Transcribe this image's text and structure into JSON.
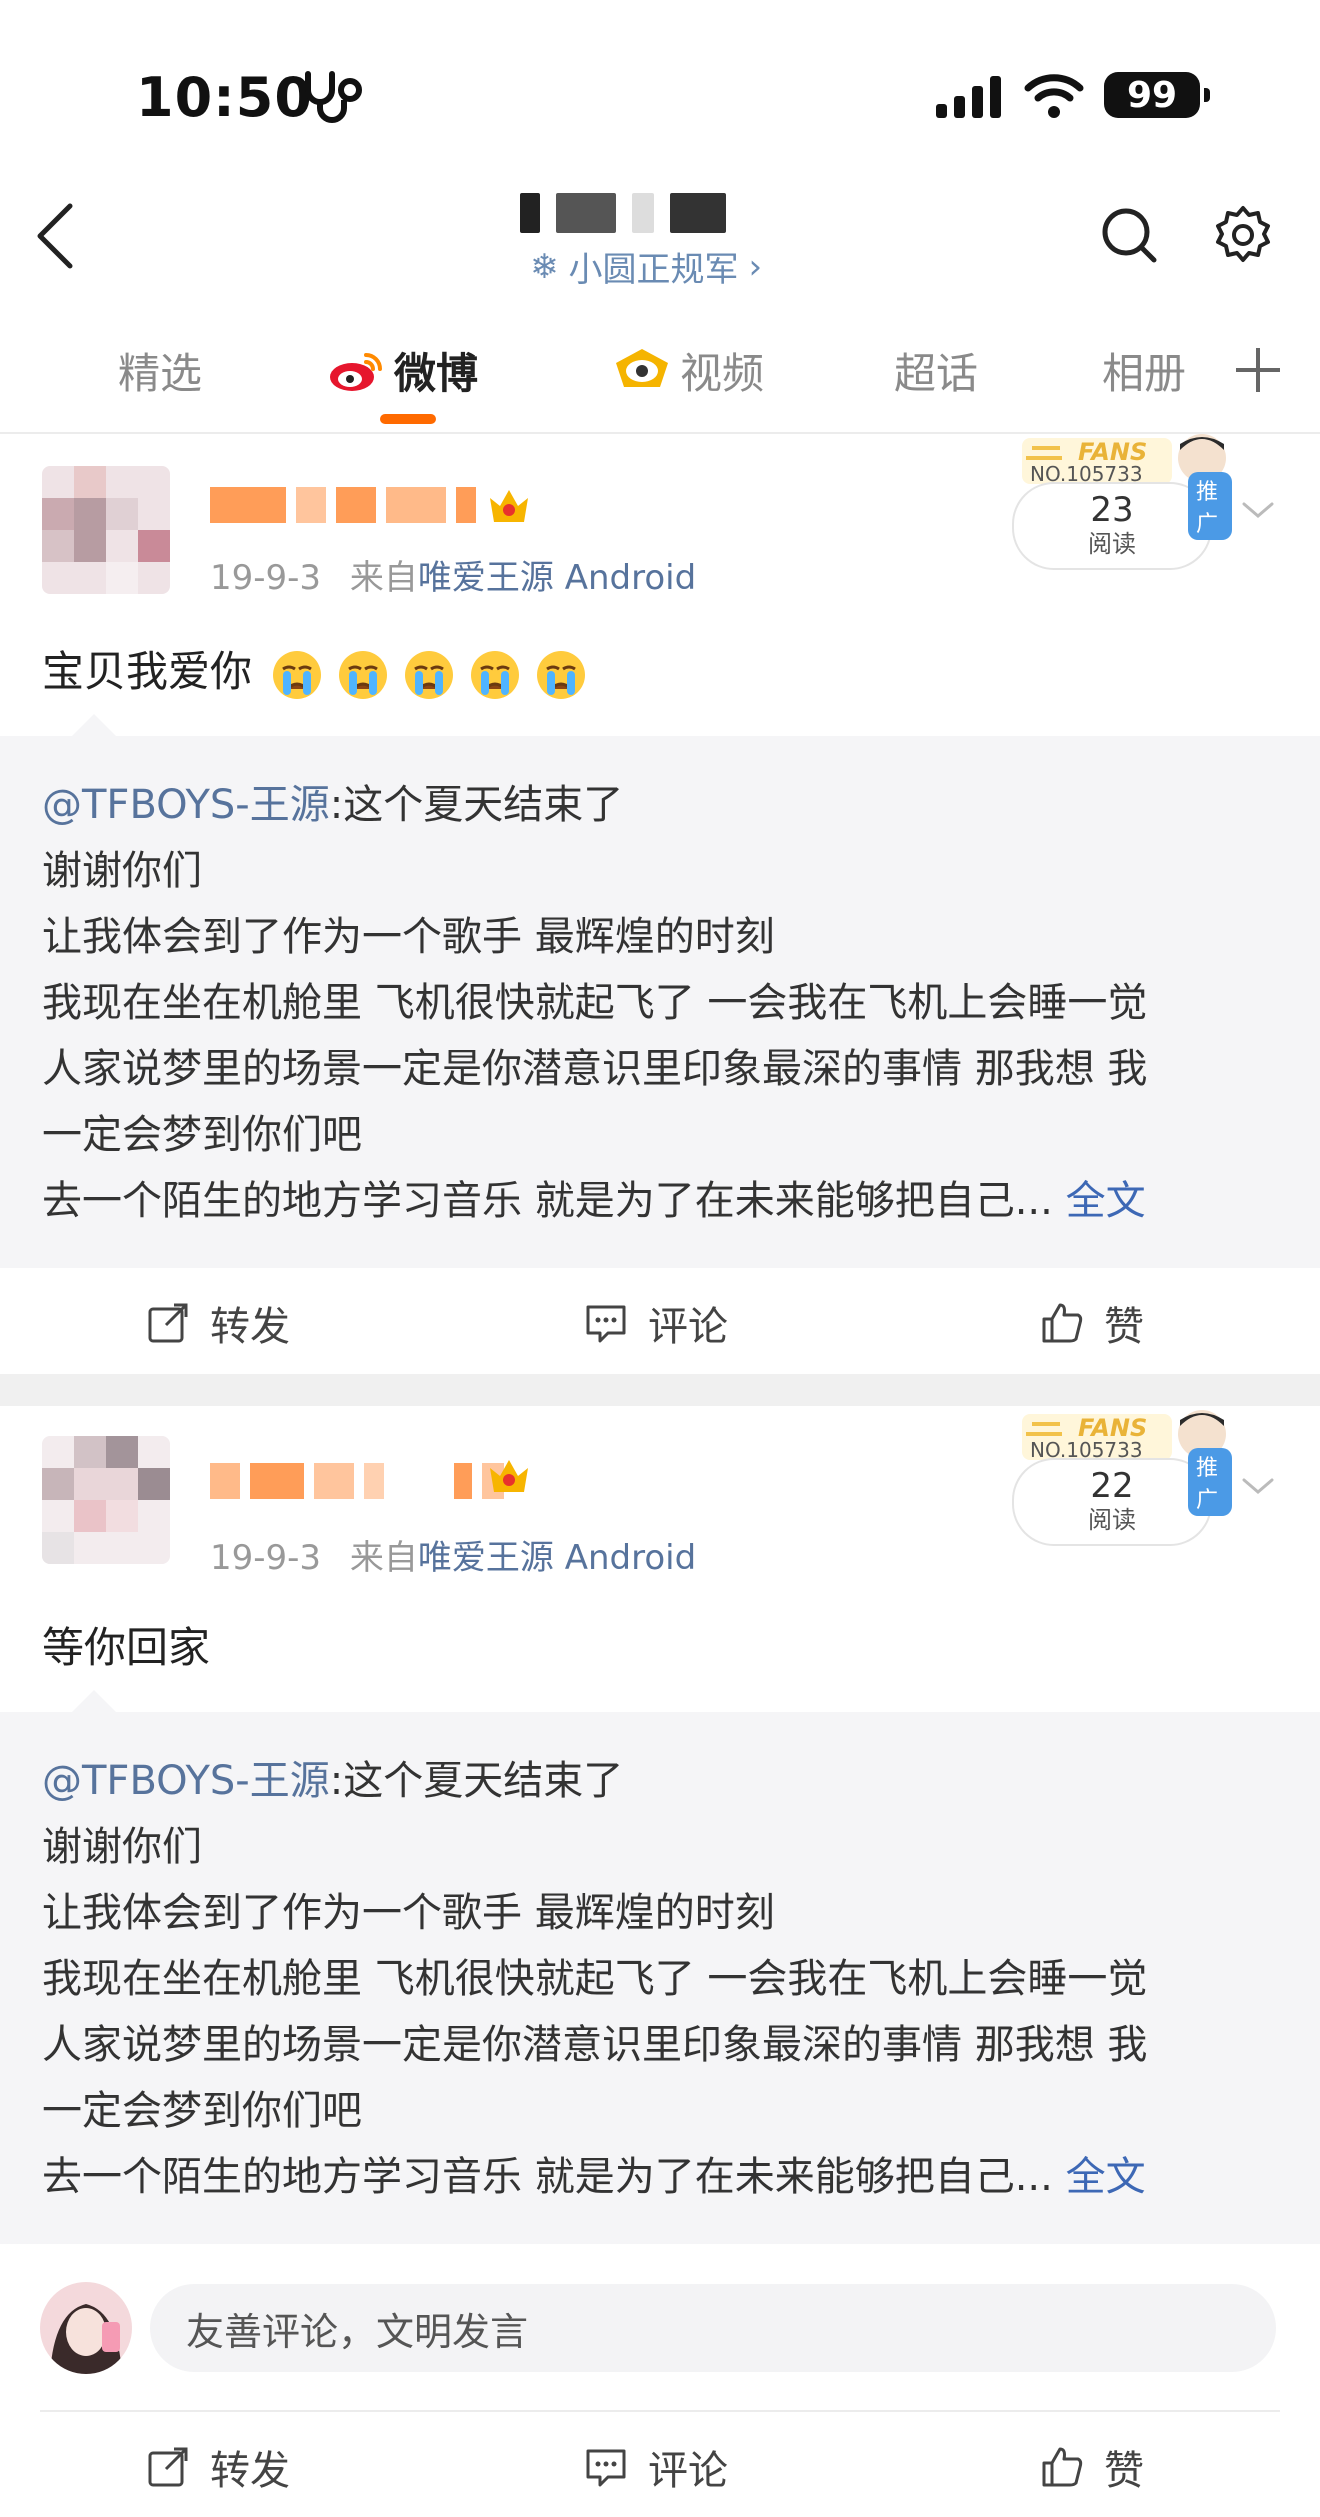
{
  "status_bar": {
    "time": "10:50",
    "battery": "99"
  },
  "nav": {
    "subtitle": "小圆正规军",
    "subtitle_chevron": "›"
  },
  "tabs": [
    {
      "label": "精选",
      "active": false
    },
    {
      "label": "微博",
      "active": true
    },
    {
      "label": "视频",
      "active": false
    },
    {
      "label": "超话",
      "active": false
    },
    {
      "label": "相册",
      "active": false
    }
  ],
  "colors": {
    "accent": "#ff6a00",
    "link": "#57739c",
    "fulltext": "#3d68b5",
    "badge": "#4b9ae6"
  },
  "posts": [
    {
      "date": "19-9-3",
      "source_prefix": "来自",
      "source": "唯爱王源 Android",
      "fans_label": "FANS",
      "fans_no": "NO.105733",
      "views": "23",
      "views_label": "阅读",
      "promo": "推广",
      "text": "宝贝我爱你",
      "emoji": "crying-face-icon",
      "emoji_count": 5,
      "repost": {
        "mention": "@TFBOYS-王源",
        "lines": [
          ":这个夏天结束了",
          "谢谢你们",
          "让我体会到了作为一个歌手 最辉煌的时刻",
          "我现在坐在机舱里 飞机很快就起飞了 一会我在飞机上会睡一觉",
          "人家说梦里的场景一定是你潜意识里印象最深的事情 那我想 我",
          "一定会梦到你们吧",
          "去一个陌生的地方学习音乐 就是为了在未来能够把自己..."
        ],
        "fulltext": "全文"
      }
    },
    {
      "date": "19-9-3",
      "source_prefix": "来自",
      "source": "唯爱王源 Android",
      "fans_label": "FANS",
      "fans_no": "NO.105733",
      "views": "22",
      "views_label": "阅读",
      "promo": "推广",
      "text": "等你回家",
      "repost": {
        "mention": "@TFBOYS-王源",
        "lines": [
          ":这个夏天结束了",
          "谢谢你们",
          "让我体会到了作为一个歌手 最辉煌的时刻",
          "我现在坐在机舱里 飞机很快就起飞了 一会我在飞机上会睡一觉",
          "人家说梦里的场景一定是你潜意识里印象最深的事情 那我想 我",
          "一定会梦到你们吧",
          "去一个陌生的地方学习音乐 就是为了在未来能够把自己..."
        ],
        "fulltext": "全文"
      }
    }
  ],
  "actions": {
    "repost": "转发",
    "comment": "评论",
    "like": "赞"
  },
  "comment_input": {
    "placeholder": "友善评论，文明发言"
  }
}
